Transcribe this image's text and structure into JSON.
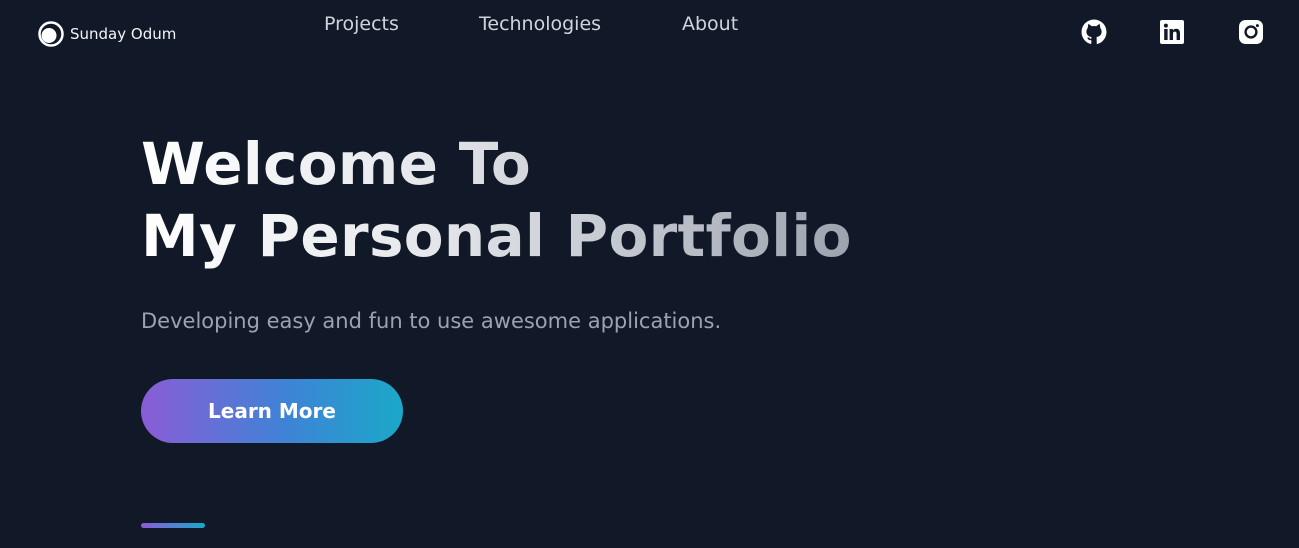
{
  "header": {
    "brand": {
      "name": "Sunday Odum",
      "icon": "logo-ring-icon"
    },
    "nav": [
      {
        "label": "Projects"
      },
      {
        "label": "Technologies"
      },
      {
        "label": "About"
      }
    ],
    "social": [
      {
        "icon": "github-icon"
      },
      {
        "icon": "linkedin-icon"
      },
      {
        "icon": "instagram-icon"
      }
    ]
  },
  "hero": {
    "title_line1": "Welcome To",
    "title_line2": "My Personal Portfolio",
    "subtitle": "Developing easy and fun to use awesome applications.",
    "cta_label": "Learn More"
  },
  "colors": {
    "background": "#111827",
    "gradient_start": "#8b5cd6",
    "gradient_end": "#1aa8c9",
    "nav_text": "#d1d5db",
    "subtitle_text": "#9ca3af"
  }
}
